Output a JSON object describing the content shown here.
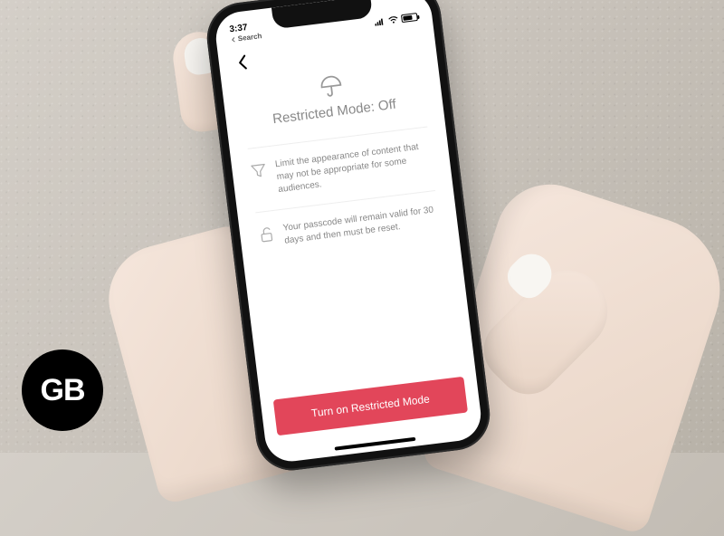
{
  "logo": {
    "text": "GB"
  },
  "status_bar": {
    "time": "3:37",
    "back_label": "Search"
  },
  "header": {
    "title": "Restricted Mode: Off"
  },
  "info_items": [
    {
      "icon": "filter",
      "text": "Limit the appearance of content that may not be appropriate for some audiences."
    },
    {
      "icon": "lock",
      "text": "Your passcode will remain valid for 30 days and then must be reset."
    }
  ],
  "primary_button": {
    "label": "Turn on Restricted Mode"
  },
  "colors": {
    "accent": "#e2465a"
  }
}
